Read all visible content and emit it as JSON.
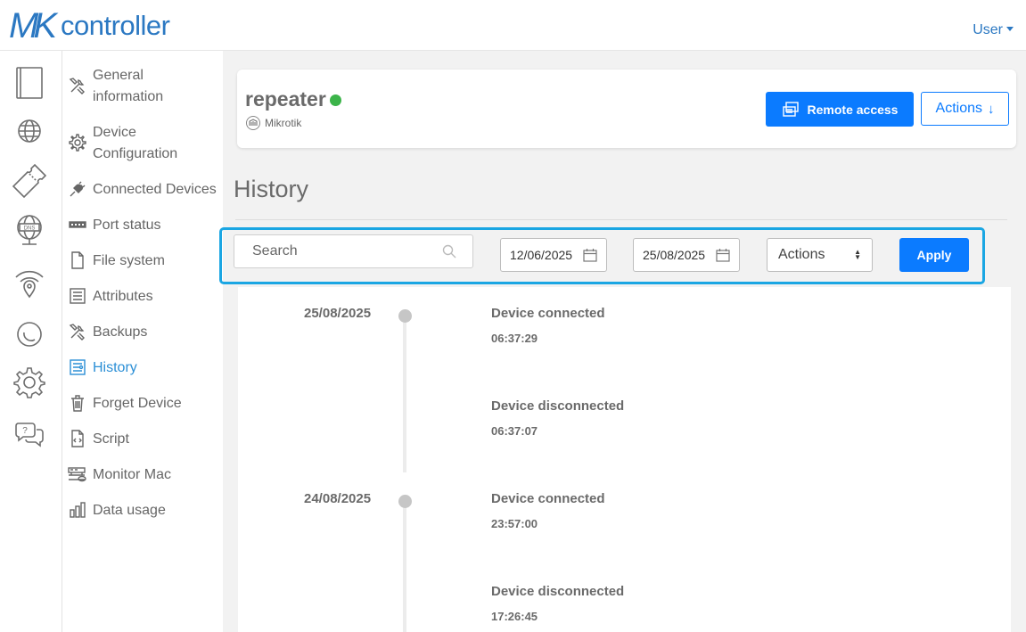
{
  "brand": {
    "mark": "MK",
    "name": "controller",
    "color": "#2b78c2"
  },
  "user_menu": {
    "label": "User"
  },
  "rail": [
    {
      "icon": "book-icon"
    },
    {
      "icon": "globe-icon"
    },
    {
      "icon": "ticket-icon"
    },
    {
      "icon": "dns-globe-icon"
    },
    {
      "icon": "wifi-location-icon"
    },
    {
      "icon": "moon-icon"
    },
    {
      "icon": "gear-icon"
    },
    {
      "icon": "help-chat-icon"
    }
  ],
  "subnav": {
    "items": [
      {
        "label": "General\ninformation",
        "icon": "tools-icon"
      },
      {
        "label": "Device\nConfiguration",
        "icon": "gear-icon"
      },
      {
        "label": "Connected Devices",
        "icon": "plug-icon"
      },
      {
        "label": "Port status",
        "icon": "ports-icon"
      },
      {
        "label": "File system",
        "icon": "file-icon"
      },
      {
        "label": "Attributes",
        "icon": "list-icon"
      },
      {
        "label": "Backups",
        "icon": "tools-icon"
      },
      {
        "label": "History",
        "icon": "history-icon",
        "active": true
      },
      {
        "label": "Forget Device",
        "icon": "trash-icon"
      },
      {
        "label": "Script",
        "icon": "code-file-icon"
      },
      {
        "label": "Monitor Mac",
        "icon": "monitor-eye-icon"
      },
      {
        "label": "Data usage",
        "icon": "bar-chart-icon"
      }
    ]
  },
  "device": {
    "name": "repeater",
    "status": "online",
    "status_color": "#3cb44a",
    "vendor": "Mikrotik",
    "remote_access_label": "Remote access",
    "actions_label": "Actions"
  },
  "history": {
    "title": "History",
    "search_placeholder": "Search",
    "date_from": "12/06/2025",
    "date_to": "25/08/2025",
    "actions_select": "Actions",
    "apply_label": "Apply",
    "entries": [
      {
        "date": "25/08/2025",
        "event": "Device connected",
        "time": "06:37:29"
      },
      {
        "date": "",
        "event": "Device disconnected",
        "time": "06:37:07"
      },
      {
        "date": "24/08/2025",
        "event": "Device connected",
        "time": "23:57:00"
      },
      {
        "date": "",
        "event": "Device disconnected",
        "time": "17:26:45"
      }
    ]
  },
  "colors": {
    "accent": "#0b7bff",
    "highlight_border": "#1aa6e3",
    "active_nav": "#2b8fd6"
  }
}
